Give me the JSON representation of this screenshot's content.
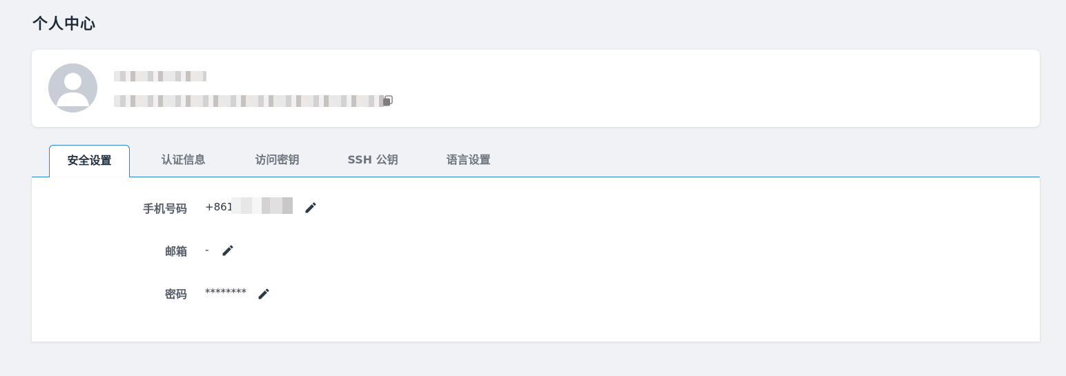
{
  "page": {
    "title": "个人中心"
  },
  "profile": {
    "avatar_icon": "user-avatar-icon",
    "name_masked": "",
    "id_masked": "",
    "copy_icon": "copy-icon"
  },
  "tabs": [
    {
      "label": "安全设置",
      "active": true
    },
    {
      "label": "认证信息",
      "active": false
    },
    {
      "label": "访问密钥",
      "active": false
    },
    {
      "label": "SSH 公钥",
      "active": false
    },
    {
      "label": "语言设置",
      "active": false
    }
  ],
  "security": {
    "phone_label": "手机号码",
    "phone_value": "+861",
    "email_label": "邮箱",
    "email_value": "-",
    "password_label": "密码",
    "password_value": "********",
    "edit_icon": "pencil-icon"
  },
  "colors": {
    "accent": "#2a87c8",
    "background": "#f0f2f5",
    "card": "#ffffff",
    "title": "#1e2a38"
  }
}
